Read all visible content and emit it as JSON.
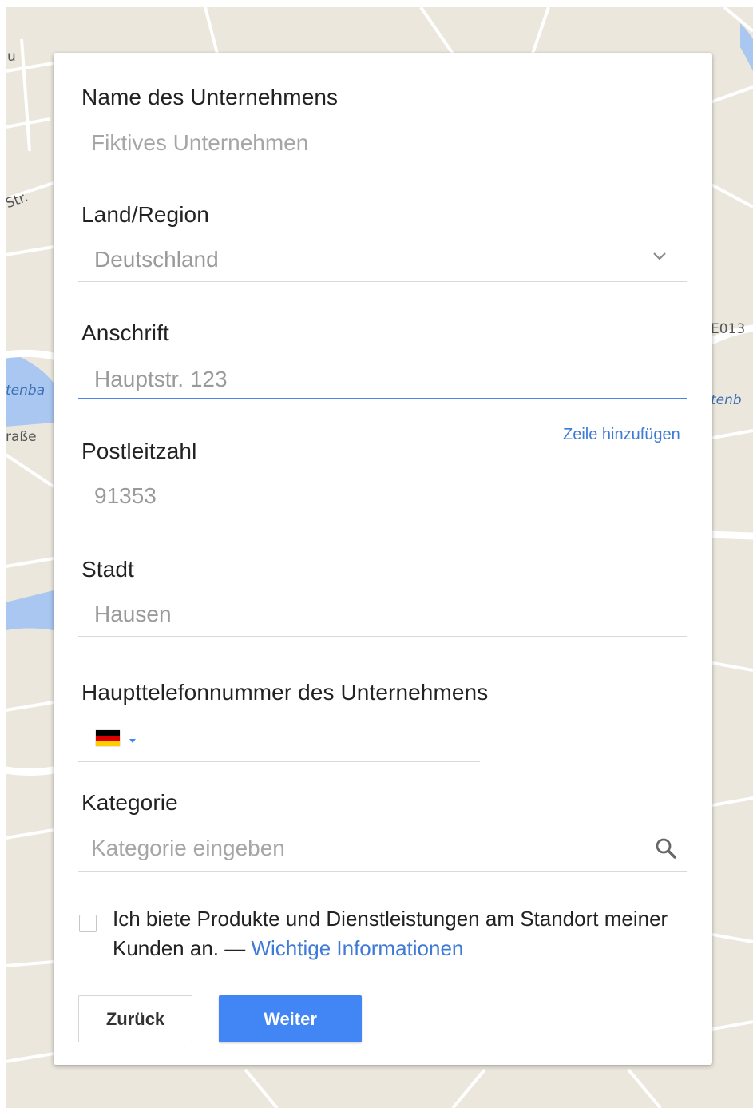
{
  "map": {
    "labels": {
      "top_left": "u",
      "street_str": "Str.",
      "left_water": "tenba",
      "left_street": "raße",
      "right_road": "E013",
      "right_water": "tenb"
    }
  },
  "form": {
    "business_name": {
      "label": "Name des Unternehmens",
      "placeholder": "Fiktives Unternehmen"
    },
    "country": {
      "label": "Land/Region",
      "value": "Deutschland",
      "icon": "chevron-down-icon"
    },
    "address": {
      "label": "Anschrift",
      "value": "Hauptstr. 123",
      "add_line_link": "Zeile hinzufügen"
    },
    "postal_code": {
      "label": "Postleitzahl",
      "value": "91353"
    },
    "city": {
      "label": "Stadt",
      "value": "Hausen"
    },
    "phone": {
      "label": "Haupttelefonnummer des Unternehmens",
      "country_flag": "flag-germany-icon",
      "dropdown_icon": "caret-down-icon",
      "value": ""
    },
    "category": {
      "label": "Kategorie",
      "placeholder": "Kategorie eingeben",
      "icon": "search-icon"
    },
    "service_area": {
      "checked": false,
      "text": "Ich biete Produkte und Dienstleistungen am Standort meiner Kunden an. —",
      "link": "Wichtige Informationen"
    },
    "buttons": {
      "back": "Zurück",
      "next": "Weiter"
    }
  },
  "colors": {
    "accent": "#4285f4",
    "link": "#3e7ad6",
    "map_background": "#ebe7dd",
    "map_water": "#a9c7f0"
  }
}
